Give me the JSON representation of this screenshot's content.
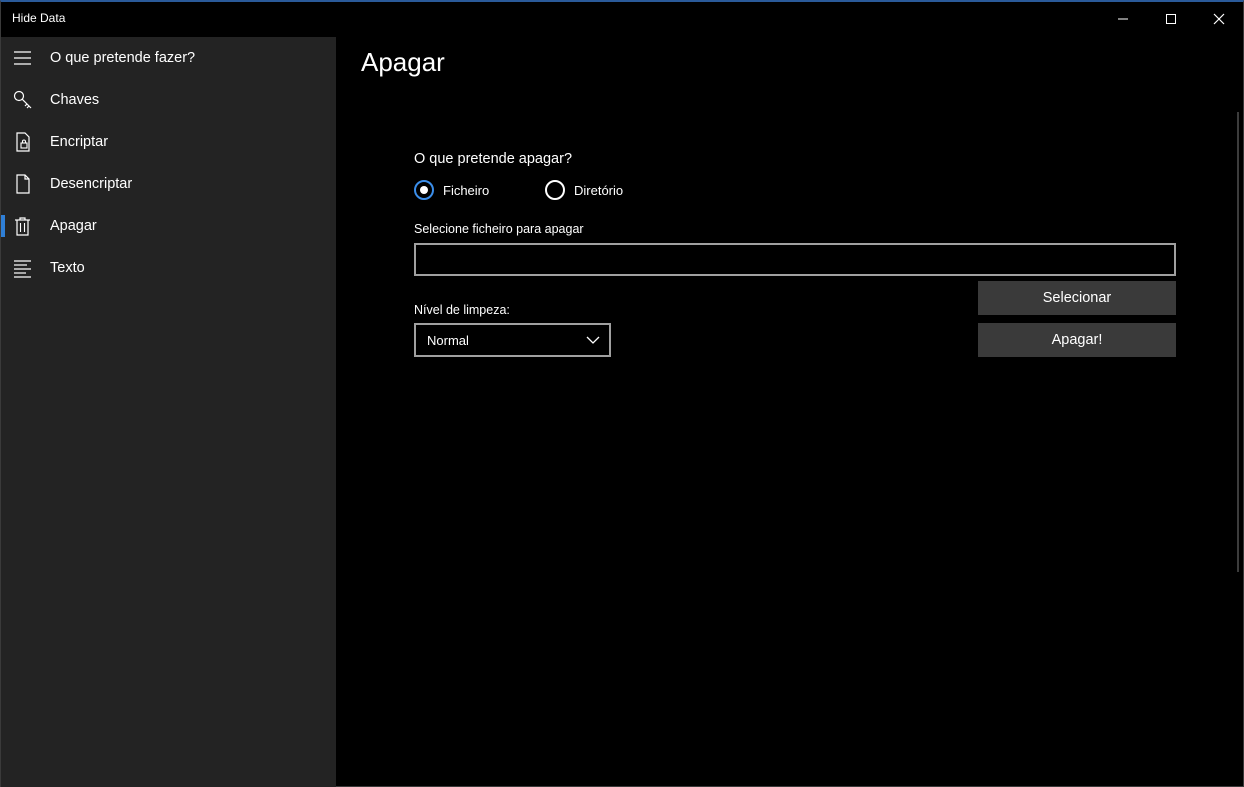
{
  "window": {
    "title": "Hide Data"
  },
  "sidebar": {
    "items": [
      {
        "label": "O que pretende fazer?",
        "icon": "hamburger-icon"
      },
      {
        "label": "Chaves",
        "icon": "key-icon"
      },
      {
        "label": "Encriptar",
        "icon": "lock-document-icon"
      },
      {
        "label": "Desencriptar",
        "icon": "document-icon"
      },
      {
        "label": "Apagar",
        "icon": "trash-icon",
        "selected": true
      },
      {
        "label": "Texto",
        "icon": "text-lines-icon"
      }
    ]
  },
  "page": {
    "title": "Apagar",
    "question": "O que pretende apagar?",
    "options": [
      {
        "label": "Ficheiro",
        "checked": true
      },
      {
        "label": "Diretório",
        "checked": false
      }
    ],
    "file_label": "Selecione ficheiro para apagar",
    "file_value": "",
    "select_button": "Selecionar",
    "delete_button": "Apagar!",
    "level_label": "Nível de limpeza:",
    "level_value": "Normal"
  },
  "colors": {
    "accent": "#2f7fd6",
    "sidebar_bg": "#232323",
    "button_bg": "#3a3a3a"
  }
}
